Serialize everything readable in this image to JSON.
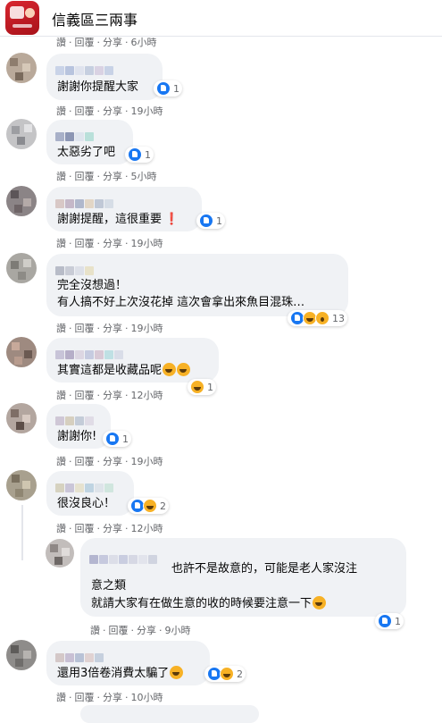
{
  "header": {
    "group_name": "信義區三兩事"
  },
  "colors": {
    "bubble": "#f0f2f5",
    "like": "#1877f2",
    "haha": "#f7b125",
    "meta": "#65676b"
  },
  "actions": {
    "like": "讚",
    "reply": "回覆",
    "share": "分享",
    "sep": "·"
  },
  "top_partial": {
    "time": "6小時"
  },
  "comments": [
    {
      "lines": [
        "謝謝你提醒大家"
      ],
      "reactions": [
        "like"
      ],
      "count": "1",
      "time": "19小時"
    },
    {
      "lines": [
        "太惡劣了吧"
      ],
      "reactions": [
        "like"
      ],
      "count": "1",
      "time": "5小時"
    },
    {
      "lines": [
        "謝謝提醒，這很重要"
      ],
      "suffix": "❗",
      "reactions": [
        "like"
      ],
      "count": "1",
      "time": "19小時"
    },
    {
      "lines": [
        "完全沒想過！",
        "有人搞不好上次沒花掉 這次會拿出來魚目混珠…"
      ],
      "reactions": [
        "like",
        "haha",
        "wow"
      ],
      "count": "13",
      "time": "19小時"
    },
    {
      "lines": [
        "其實這都是收藏品呢"
      ],
      "reactions": [
        "haha"
      ],
      "count": "1",
      "time": "12小時"
    },
    {
      "lines": [
        "謝謝你!"
      ],
      "reactions": [
        "like"
      ],
      "count": "1",
      "time": "19小時"
    },
    {
      "lines": [
        "很沒良心！"
      ],
      "reactions": [
        "like",
        "haha"
      ],
      "count": "2",
      "time": "12小時"
    },
    {
      "lines": [
        "也許不是故意的，可能是老人家沒注",
        "意之類",
        "就請大家有在做生意的收的時候要注意一下"
      ],
      "reactions": [
        "like"
      ],
      "count": "1",
      "time": "9小時"
    },
    {
      "lines": [
        "還用3倍卷消費太騙了"
      ],
      "reactions": [
        "like",
        "haha"
      ],
      "count": "2",
      "time": "10小時"
    }
  ]
}
